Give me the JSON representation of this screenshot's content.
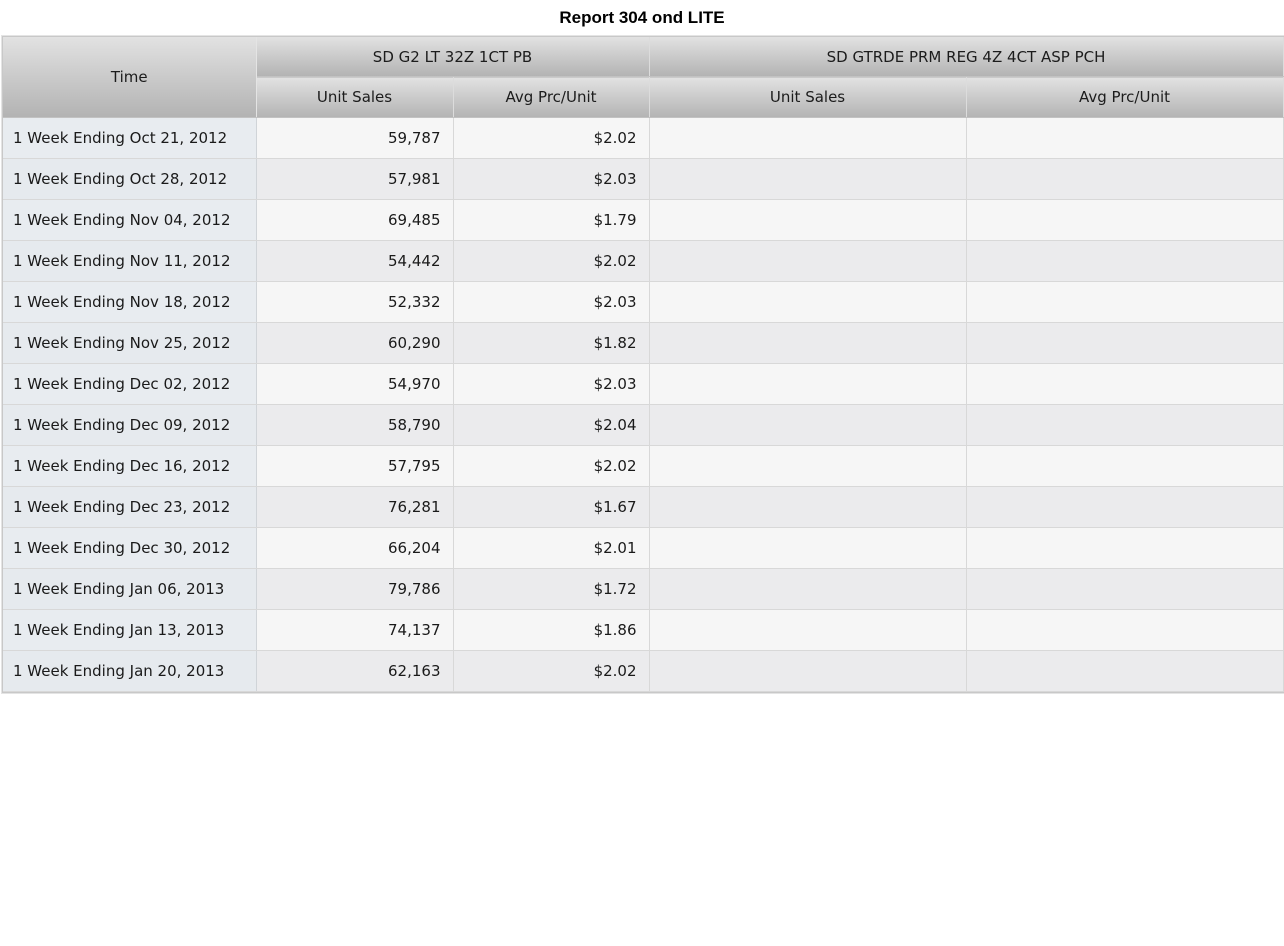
{
  "report": {
    "title": "Report 304 ond LITE"
  },
  "table": {
    "time_header": "Time",
    "groups": [
      {
        "name": "SD G2 LT 32Z 1CT PB",
        "columns": [
          "Unit Sales",
          "Avg Prc/Unit"
        ]
      },
      {
        "name": "SD GTRDE PRM REG 4Z 4CT ASP PCH",
        "columns": [
          "Unit Sales",
          "Avg Prc/Unit"
        ]
      }
    ],
    "rows": [
      {
        "time": "1 Week Ending Oct 21, 2012",
        "g1_units": "59,787",
        "g1_avg": "$2.02",
        "g2_units": "",
        "g2_avg": ""
      },
      {
        "time": "1 Week Ending Oct 28, 2012",
        "g1_units": "57,981",
        "g1_avg": "$2.03",
        "g2_units": "",
        "g2_avg": ""
      },
      {
        "time": "1 Week Ending Nov 04, 2012",
        "g1_units": "69,485",
        "g1_avg": "$1.79",
        "g2_units": "",
        "g2_avg": ""
      },
      {
        "time": "1 Week Ending Nov 11, 2012",
        "g1_units": "54,442",
        "g1_avg": "$2.02",
        "g2_units": "",
        "g2_avg": ""
      },
      {
        "time": "1 Week Ending Nov 18, 2012",
        "g1_units": "52,332",
        "g1_avg": "$2.03",
        "g2_units": "",
        "g2_avg": ""
      },
      {
        "time": "1 Week Ending Nov 25, 2012",
        "g1_units": "60,290",
        "g1_avg": "$1.82",
        "g2_units": "",
        "g2_avg": ""
      },
      {
        "time": "1 Week Ending Dec 02, 2012",
        "g1_units": "54,970",
        "g1_avg": "$2.03",
        "g2_units": "",
        "g2_avg": ""
      },
      {
        "time": "1 Week Ending Dec 09, 2012",
        "g1_units": "58,790",
        "g1_avg": "$2.04",
        "g2_units": "",
        "g2_avg": ""
      },
      {
        "time": "1 Week Ending Dec 16, 2012",
        "g1_units": "57,795",
        "g1_avg": "$2.02",
        "g2_units": "",
        "g2_avg": ""
      },
      {
        "time": "1 Week Ending Dec 23, 2012",
        "g1_units": "76,281",
        "g1_avg": "$1.67",
        "g2_units": "",
        "g2_avg": ""
      },
      {
        "time": "1 Week Ending Dec 30, 2012",
        "g1_units": "66,204",
        "g1_avg": "$2.01",
        "g2_units": "",
        "g2_avg": ""
      },
      {
        "time": "1 Week Ending Jan 06, 2013",
        "g1_units": "79,786",
        "g1_avg": "$1.72",
        "g2_units": "",
        "g2_avg": ""
      },
      {
        "time": "1 Week Ending Jan 13, 2013",
        "g1_units": "74,137",
        "g1_avg": "$1.86",
        "g2_units": "",
        "g2_avg": ""
      },
      {
        "time": "1 Week Ending Jan 20, 2013",
        "g1_units": "62,163",
        "g1_avg": "$2.02",
        "g2_units": "",
        "g2_avg": ""
      }
    ]
  }
}
